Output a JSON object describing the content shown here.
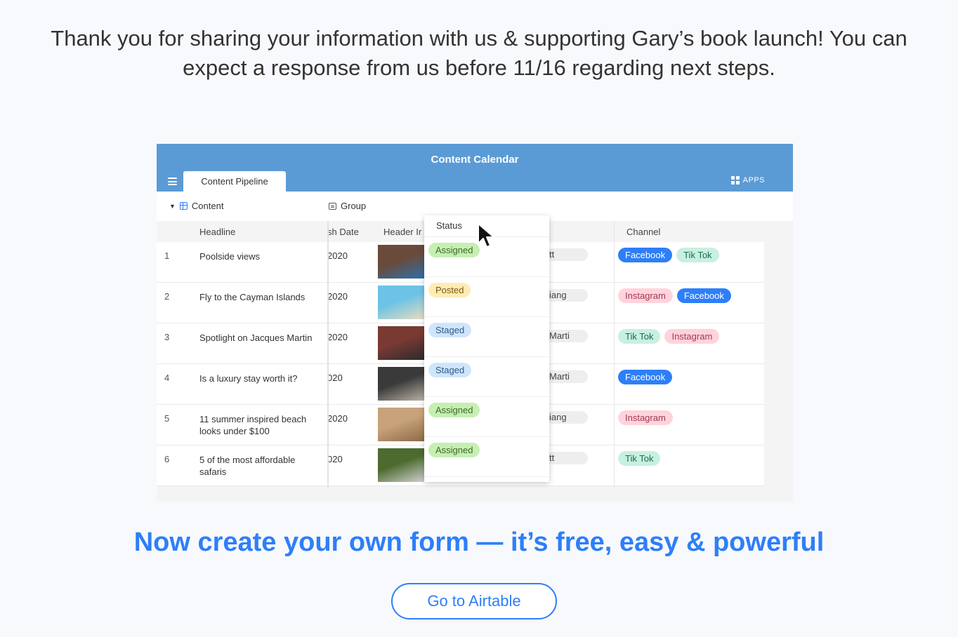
{
  "message": {
    "line1": "Thank you for sharing your information with us & supporting Gary’s book launch! You can",
    "line2": "expect a response from us before 11/16 regarding next steps."
  },
  "app": {
    "title": "Content Calendar",
    "tab": "Content Pipeline",
    "apps_label": "APPS",
    "toolbar": {
      "table": "Content",
      "group": "Group"
    },
    "columns": {
      "headline": "Headline",
      "date": "sh Date",
      "image": "Header Ir",
      "status": "Status",
      "channel": "Channel"
    },
    "rows": [
      {
        "num": "1",
        "headline": "Poolside views",
        "date": "2020",
        "person": "tt",
        "status": "Assigned",
        "status_type": "assigned",
        "channels": [
          "Facebook",
          "Tik Tok"
        ]
      },
      {
        "num": "2",
        "headline": "Fly to the Cayman Islands",
        "date": "2020",
        "person": "iang",
        "status": "Posted",
        "status_type": "posted",
        "channels": [
          "Instagram",
          "Facebook"
        ]
      },
      {
        "num": "3",
        "headline": "Spotlight on Jacques Martin",
        "date": "2020",
        "person": "Marti",
        "status": "Staged",
        "status_type": "staged",
        "channels": [
          "Tik Tok",
          "Instagram"
        ]
      },
      {
        "num": "4",
        "headline": "Is a luxury stay worth it?",
        "date": "020",
        "person": "Marti",
        "status": "Staged",
        "status_type": "staged",
        "channels": [
          "Facebook"
        ]
      },
      {
        "num": "5",
        "headline": "11 summer inspired beach looks under $100",
        "date": "2020",
        "person": "iang",
        "status": "Assigned",
        "status_type": "assigned",
        "channels": [
          "Instagram"
        ]
      },
      {
        "num": "6",
        "headline": "5 of the most affordable safaris",
        "date": "020",
        "person": "tt",
        "status": "Assigned",
        "status_type": "assigned",
        "channels": [
          "Tik Tok"
        ]
      }
    ],
    "thumb_colors": [
      [
        "#6a4a3a",
        "#2f6fa8"
      ],
      [
        "#6cc3e6",
        "#e8dcc0"
      ],
      [
        "#7a3a34",
        "#2b2b2b"
      ],
      [
        "#3a3a3a",
        "#b9b1a5"
      ],
      [
        "#c8a27a",
        "#8c6a48"
      ],
      [
        "#4d6b2f",
        "#cfcfcf"
      ]
    ]
  },
  "cta": "Now create your own form — it’s free, easy & powerful",
  "button": "Go to Airtable"
}
